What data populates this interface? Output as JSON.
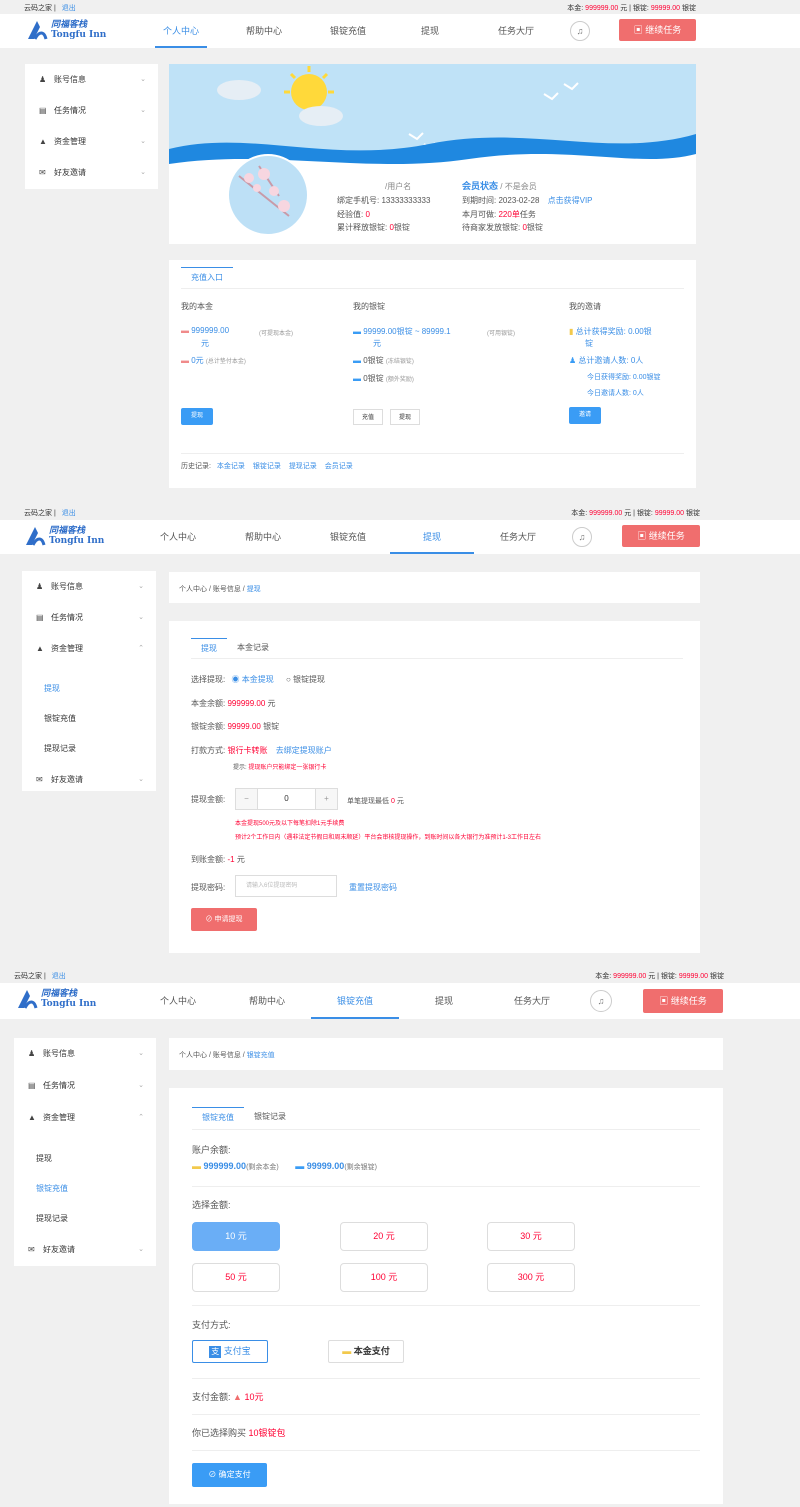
{
  "site": {
    "name": "云码之家",
    "logout": "退出",
    "logo_cn": "同福客栈",
    "logo_en": "Tongfu Inn"
  },
  "balance": {
    "principal_label": "本金:",
    "principal": "999999.00",
    "unit": "元",
    "ingot_label": "银锭:",
    "ingot": "99999.00",
    "ingot_unit": "银锭"
  },
  "nav": {
    "items": [
      "个人中心",
      "帮助中心",
      "银锭充值",
      "提现",
      "任务大厅"
    ],
    "task_button": "继续任务"
  },
  "sidebar": {
    "account": "账号信息",
    "tasks": "任务情况",
    "funds": "资金管理",
    "invite": "好友邀请",
    "sub": [
      "提现",
      "银锭充值",
      "提现记录"
    ]
  },
  "s1": {
    "profile": {
      "username": "/用户名",
      "phone_label": "绑定手机号:",
      "phone": "13333333333",
      "exp_label": "经验值:",
      "exp": "0",
      "total_label": "累计释放银锭:",
      "total": "0",
      "total_unit": "银锭",
      "member_label": "会员状态",
      "member_value": "/ 不是会员",
      "expire_label": "到期时间:",
      "expire": "2023-02-28",
      "vip_link": "点击获得VIP",
      "month_label": "本月可做:",
      "month": "220单",
      "month_unit": "任务",
      "pending_label": "待商家发放银锭:",
      "pending": "0",
      "pending_unit": "银锭"
    },
    "tab": "充值入口",
    "col1": {
      "title": "我的本金",
      "v1": "999999.00",
      "v1_unit": "元",
      "v1_note": "(可提现本金)",
      "v2": "0元",
      "v2_note": "(总计垫付本金)",
      "btn": "提现"
    },
    "col2": {
      "title": "我的银锭",
      "v1": "99999.00银锭 ~ 89999.1",
      "v1_unit": "元",
      "v1_note": "(可用银锭)",
      "v2": "0银锭",
      "v2_note": "(冻结银锭)",
      "v3": "0银锭",
      "v3_note": "(额外奖励)",
      "btn1": "充值",
      "btn2": "提现"
    },
    "col3": {
      "title": "我的邀请",
      "l1": "总计获得奖励: 0.00银",
      "l1b": "锭",
      "l2": "总计邀请人数: 0人",
      "l3": "今日获得奖励: 0.00银锭",
      "l4": "今日邀请人数: 0人",
      "btn": "邀请"
    },
    "history_label": "历史记录:",
    "history": [
      "本金记录",
      "银锭记录",
      "提现记录",
      "会员记录"
    ]
  },
  "s2": {
    "breadcrumb": "个人中心 / 账号信息 /",
    "breadcrumb_cur": "提现",
    "tabs": [
      "提现",
      "本金记录"
    ],
    "choose_label": "选择提现:",
    "radio1": "本金提现",
    "radio2": "银锭提现",
    "principal_label": "本金余额:",
    "principal": "999999.00",
    "principal_unit": "元",
    "ingot_label": "银锭余额:",
    "ingot": "99999.00",
    "ingot_unit": "银锭",
    "pay_label": "打款方式:",
    "pay_method": "银行卡转账",
    "bind_link": "去绑定提现账户",
    "tip_label": "提示:",
    "tip": "提现账户只能绑定一张银行卡",
    "amount_label": "提现金额:",
    "amount_value": "0",
    "min_label": "单笔提现最低",
    "min": "0",
    "min_unit": "元",
    "warn1": "本金提现500元及以下每笔扣除1元手续费",
    "warn2": "预计2个工作日内（遇非法定节假日和周末顺延）平台会审核提现操作，到账时间以各大银行为准预计1-3工作日左右",
    "arrive_label": "到账金额:",
    "arrive": "-1",
    "arrive_unit": "元",
    "pwd_label": "提现密码:",
    "pwd_placeholder": "请输入6位提现密码",
    "reset_link": "重置提现密码",
    "submit": "申请提现"
  },
  "s3": {
    "breadcrumb": "个人中心 / 账号信息 /",
    "breadcrumb_cur": "银锭充值",
    "tabs": [
      "银锭充值",
      "银锭记录"
    ],
    "balance_label": "账户余额:",
    "principal": "999999.00",
    "principal_note": "(剩余本金)",
    "ingot": "99999.00",
    "ingot_note": "(剩余银锭)",
    "choose_label": "选择金额:",
    "amounts": [
      "10 元",
      "20 元",
      "30 元",
      "50 元",
      "100 元",
      "300 元"
    ],
    "paymethod_label": "支付方式:",
    "alipay": "支付宝",
    "principal_pay": "本金支付",
    "payamount_label": "支付金额:",
    "payamount": "10元",
    "buy_label": "你已选择购买",
    "buy_value": "10银锭包",
    "confirm": "确定支付"
  },
  "colors": {
    "accent": "#3a8ee6",
    "danger": "#f06e6e",
    "price": "#ff0033"
  }
}
